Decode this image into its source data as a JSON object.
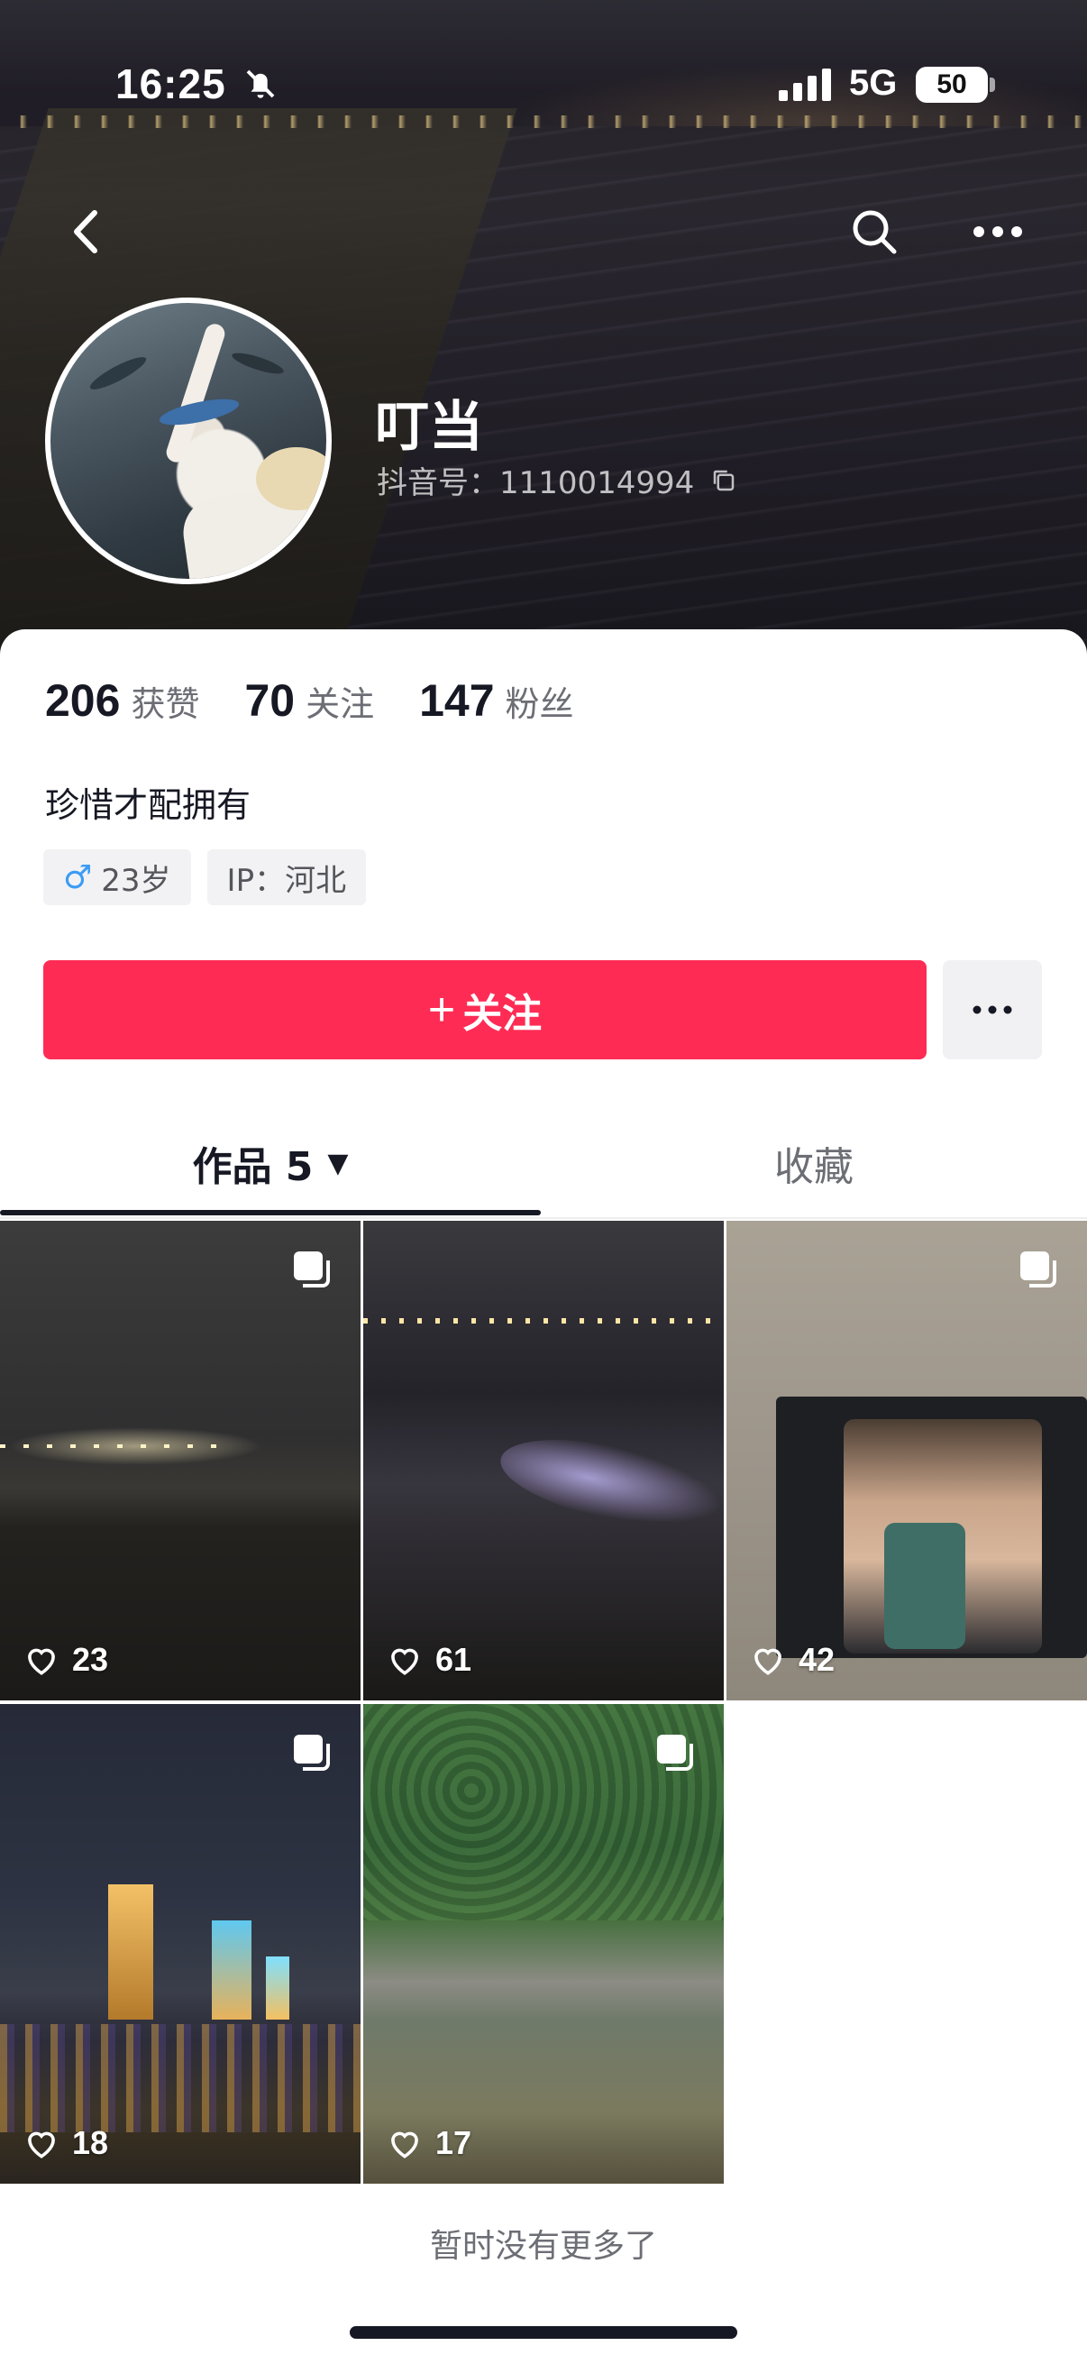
{
  "status_bar": {
    "time": "16:25",
    "network": "5G",
    "battery": "50",
    "icons": [
      "bell-muted-icon",
      "signal-icon",
      "battery-icon"
    ]
  },
  "nav": {
    "icons": [
      "back-chevron-icon",
      "search-icon",
      "more-dots-icon"
    ]
  },
  "profile": {
    "name": "叮当",
    "douyin_id": "抖音号：1110014994",
    "stats": [
      {
        "num": "206",
        "label": "获赞"
      },
      {
        "num": "70",
        "label": "关注"
      },
      {
        "num": "147",
        "label": "粉丝"
      }
    ],
    "bio": "珍惜才配拥有",
    "tags": {
      "gender_symbol": "♂",
      "age": "23岁",
      "ip": "IP：河北"
    }
  },
  "actions": {
    "follow_plus": "+",
    "follow_label": "关注",
    "more_icon": "more-dots-icon"
  },
  "tabs": {
    "works": "作品 5",
    "works_caret": "▼",
    "favorites": "收藏"
  },
  "posts": [
    {
      "likes": "23",
      "multi_image": true
    },
    {
      "likes": "61",
      "multi_image": false
    },
    {
      "likes": "42",
      "multi_image": true
    },
    {
      "likes": "18",
      "multi_image": true
    },
    {
      "likes": "17",
      "multi_image": true
    }
  ],
  "footer": {
    "empty_note": "暂时没有更多了"
  },
  "colors": {
    "accent": "#fe2c55",
    "text": "#161823",
    "muted": "#6d6e75"
  }
}
